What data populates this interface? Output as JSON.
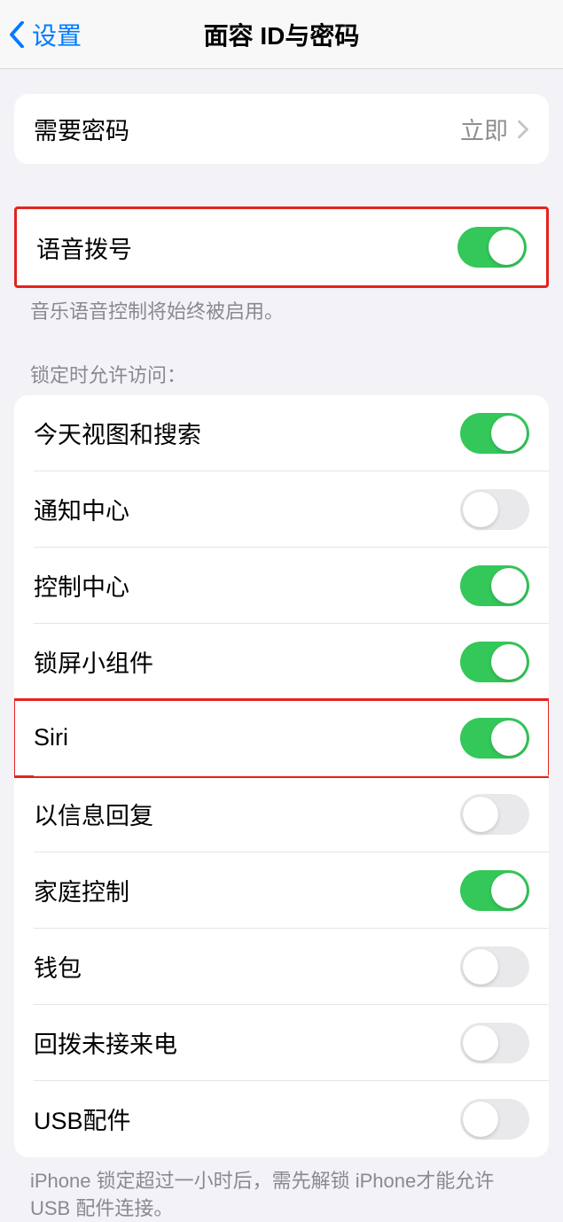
{
  "navbar": {
    "back_label": "设置",
    "title": "面容 ID与密码"
  },
  "require_passcode": {
    "label": "需要密码",
    "value": "立即"
  },
  "voice_dial": {
    "label": "语音拨号",
    "on": true,
    "footer": "音乐语音控制将始终被启用。"
  },
  "allow_access": {
    "header": "锁定时允许访问：",
    "items": [
      {
        "label": "今天视图和搜索",
        "on": true
      },
      {
        "label": "通知中心",
        "on": false
      },
      {
        "label": "控制中心",
        "on": true
      },
      {
        "label": "锁屏小组件",
        "on": true
      },
      {
        "label": "Siri",
        "on": true,
        "highlight": true
      },
      {
        "label": "以信息回复",
        "on": false
      },
      {
        "label": "家庭控制",
        "on": true
      },
      {
        "label": "钱包",
        "on": false
      },
      {
        "label": "回拨未接来电",
        "on": false
      },
      {
        "label": "USB配件",
        "on": false
      }
    ],
    "footer": "iPhone 锁定超过一小时后，需先解锁 iPhone才能允许USB 配件连接。"
  }
}
